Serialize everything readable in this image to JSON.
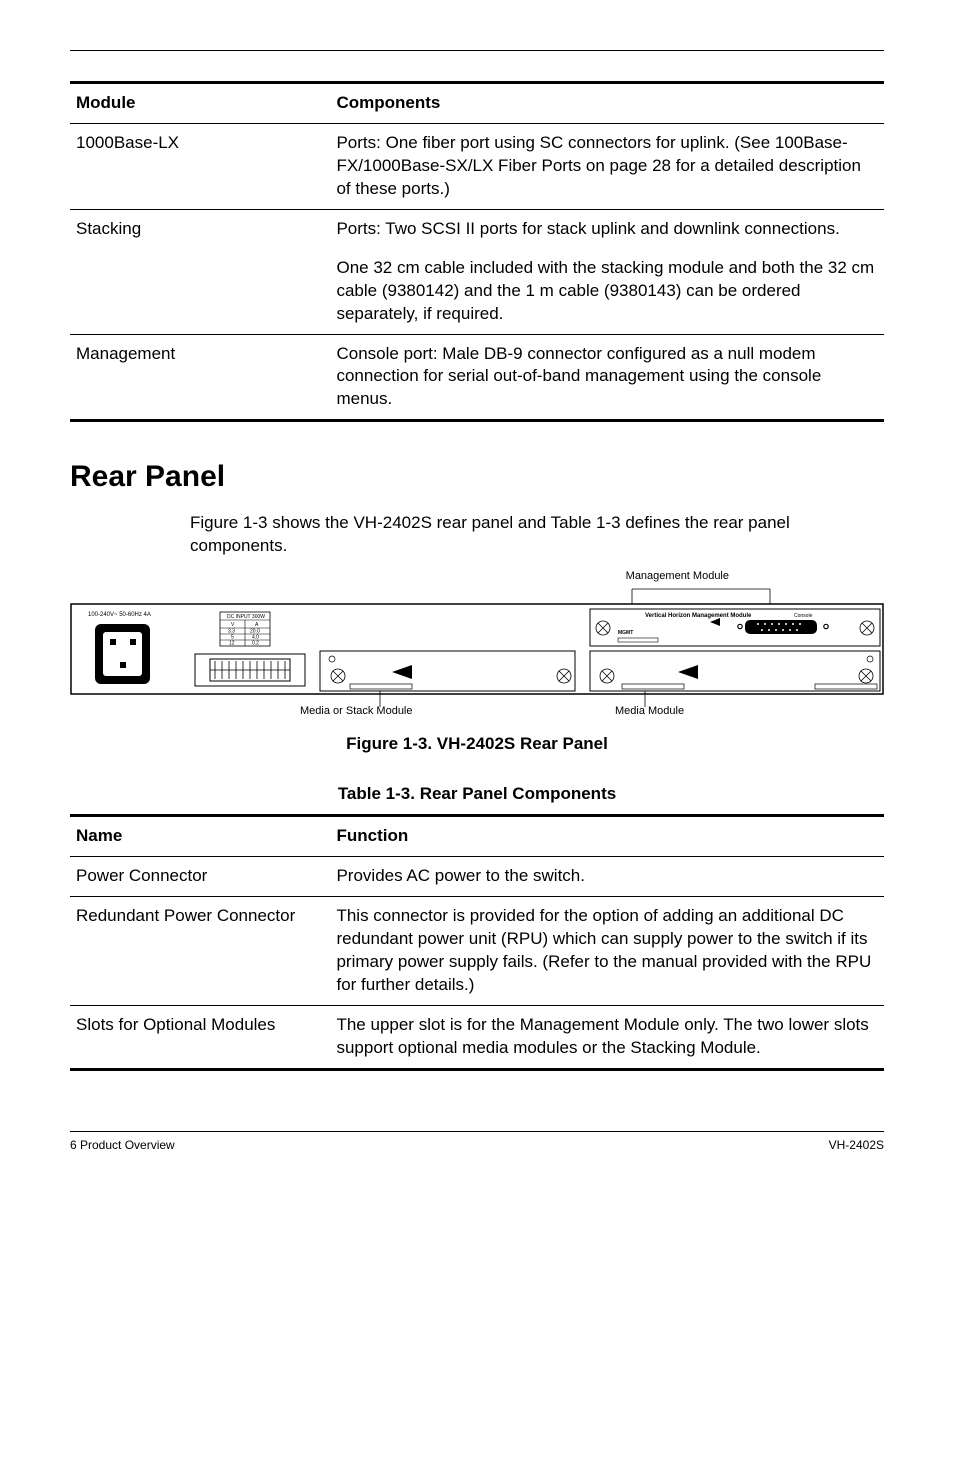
{
  "top_table": {
    "headers": [
      "Module",
      "Components"
    ],
    "rows": [
      {
        "module": "1000Base-LX",
        "components": "Ports: One fiber port using SC connectors for uplink. (See 100Base-FX/1000Base-SX/LX Fiber Ports on page 28 for a detailed description of these ports.)"
      },
      {
        "module": "Stacking",
        "components": "Ports: Two SCSI II ports for stack uplink and downlink connections."
      },
      {
        "module": "",
        "components": "One 32 cm cable included with the stacking module and both the 32 cm cable (9380142) and the 1 m cable (9380143) can be ordered separately, if required."
      },
      {
        "module": "Management",
        "components": "Console port: Male DB-9 connector configured as a null modem connection for serial out-of-band management using the console menus."
      }
    ]
  },
  "section_title": "Rear Panel",
  "section_para": "Figure 1-3 shows the VH-2402S rear panel and Table 1-3 defines the rear panel components.",
  "figure": {
    "top_label": "Management Module",
    "bottom_labels": {
      "left": "Media or Stack Module",
      "right": "Media Module"
    },
    "caption": "Figure 1-3.  VH-2402S Rear Panel",
    "panel": {
      "power_spec": "100-240V~ 50-60Hz 4A",
      "dc_header": "DC INPUT\n300W",
      "dc_rows": [
        [
          "V",
          "A"
        ],
        [
          "3.3",
          "20.0"
        ],
        [
          "5",
          "4.0"
        ],
        [
          "12",
          "0.2"
        ]
      ],
      "mgmt_title": "Vertical Horizon Management Module",
      "mgmt_label": "MGMT",
      "console_label": "Console"
    }
  },
  "table1_3": {
    "caption": "Table 1-3.  Rear Panel Components",
    "headers": [
      "Name",
      "Function"
    ],
    "rows": [
      {
        "name": "Power Connector",
        "function": "Provides AC power to the switch."
      },
      {
        "name": "Redundant Power Connector",
        "function": "This connector is provided for the option of adding an additional DC redundant power unit (RPU) which can supply power to the switch if its primary power supply fails. (Refer to the manual provided with the RPU for further details.)"
      },
      {
        "name": "Slots for Optional Modules",
        "function": "The upper slot is for the Management Module only. The two lower slots support optional media modules or the Stacking Module."
      }
    ]
  },
  "footer": {
    "left": "6  Product Overview",
    "right": "VH-2402S"
  }
}
